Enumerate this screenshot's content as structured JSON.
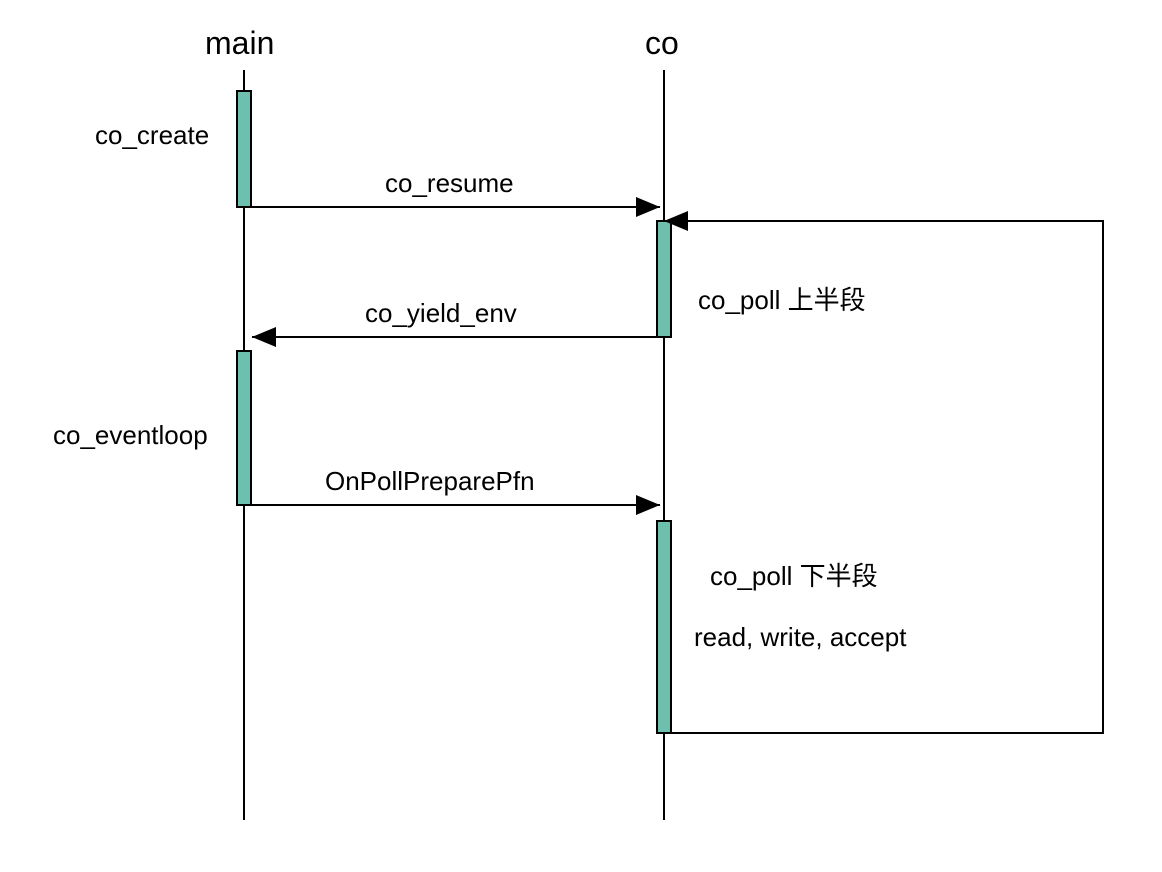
{
  "participants": {
    "main": {
      "label": "main"
    },
    "co": {
      "label": "co"
    }
  },
  "side_labels": {
    "co_create": "co_create",
    "co_eventloop": "co_eventloop"
  },
  "messages": {
    "co_resume": "co_resume",
    "co_yield_env": "co_yield_env",
    "on_poll_prepare_pfn": "OnPollPreparePfn"
  },
  "right_labels": {
    "co_poll_upper": "co_poll 上半段",
    "co_poll_lower": "co_poll 下半段",
    "read_write_accept": "read, write, accept"
  },
  "chart_data": {
    "type": "sequence_diagram",
    "participants": [
      "main",
      "co"
    ],
    "events": [
      {
        "participant": "main",
        "activation_start": true,
        "label": "co_create"
      },
      {
        "from": "main",
        "to": "co",
        "label": "co_resume",
        "direction": "right"
      },
      {
        "participant": "co",
        "activation_start": true,
        "label": "co_poll 上半段"
      },
      {
        "from": "co",
        "to": "main",
        "label": "co_yield_env",
        "direction": "left"
      },
      {
        "participant": "main",
        "activation_start": true,
        "label": "co_eventloop"
      },
      {
        "from": "main",
        "to": "co",
        "label": "OnPollPreparePfn",
        "direction": "right"
      },
      {
        "participant": "co",
        "activation_start": true,
        "label": "co_poll 下半段"
      },
      {
        "participant": "co",
        "label": "read, write, accept"
      },
      {
        "from": "co",
        "to": "co",
        "label": "",
        "direction": "loop_back"
      }
    ]
  }
}
